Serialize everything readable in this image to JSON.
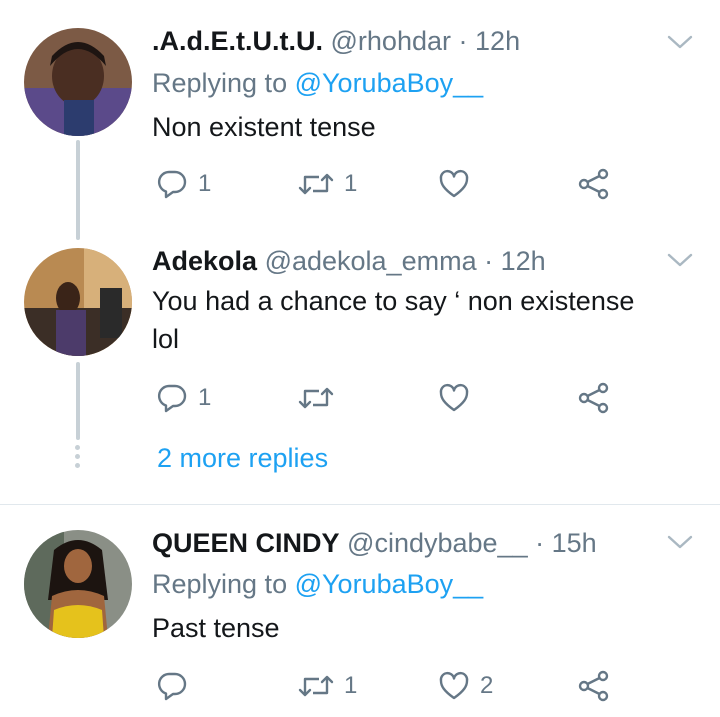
{
  "tweets": [
    {
      "name": ".A.d.E.t.U.t.U.",
      "handle": "@rhohdar",
      "time": "12h",
      "replying_prefix": "Replying to",
      "replying_to": "@YorubaBoy__",
      "text": "Non existent tense",
      "replies": "1",
      "retweets": "1",
      "likes": ""
    },
    {
      "name": "Adekola",
      "handle": "@adekola_emma",
      "time": "12h",
      "text_line1": "You had a chance to say ‘ non existense",
      "text_line2": "lol",
      "replies": "1",
      "retweets": "",
      "likes": ""
    },
    {
      "name": "QUEEN CINDY",
      "handle": "@cindybabe__",
      "time": "15h",
      "replying_prefix": "Replying to",
      "replying_to": "@YorubaBoy__",
      "text": "Past tense",
      "replies": "",
      "retweets": "1",
      "likes": "2"
    }
  ],
  "thread": {
    "more_replies": "2 more replies"
  },
  "separator": "·",
  "colors": {
    "text": "#14171a",
    "secondary": "#657786",
    "link": "#1da1f2",
    "thread_line": "#c7d0d6",
    "divider": "#e1e8ed"
  },
  "icons": [
    "chevron-down-icon",
    "reply-icon",
    "retweet-icon",
    "like-icon",
    "share-icon"
  ]
}
